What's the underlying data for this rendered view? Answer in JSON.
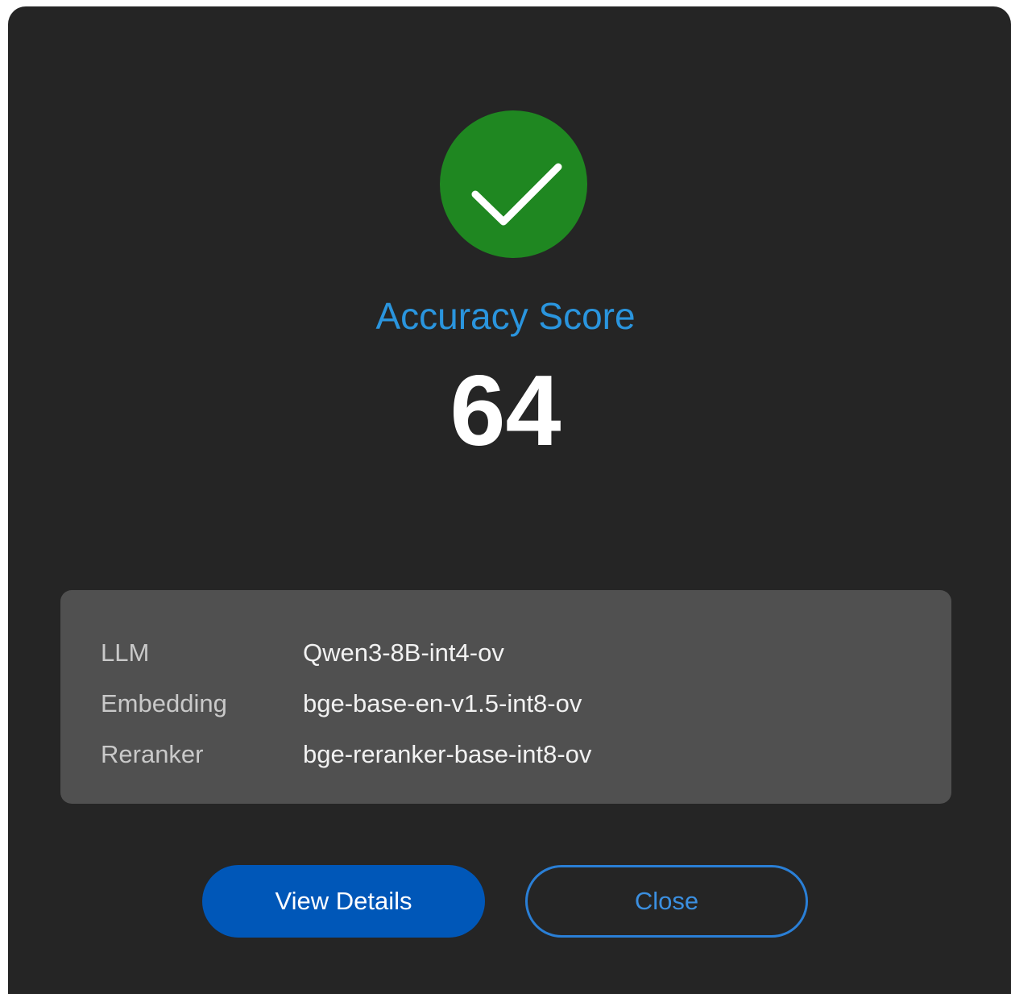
{
  "result": {
    "status_icon": "check-icon",
    "status_color": "#1f8721",
    "title": "Accuracy Score",
    "score": "64"
  },
  "models": [
    {
      "label": "LLM",
      "value": "Qwen3-8B-int4-ov"
    },
    {
      "label": "Embedding",
      "value": "bge-base-en-v1.5-int8-ov"
    },
    {
      "label": "Reranker",
      "value": "bge-reranker-base-int8-ov"
    }
  ],
  "actions": {
    "view_details_label": "View Details",
    "close_label": "Close"
  },
  "colors": {
    "background": "#252525",
    "panel": "#505050",
    "accent": "#2a95de",
    "primary_button": "#0057b8"
  }
}
